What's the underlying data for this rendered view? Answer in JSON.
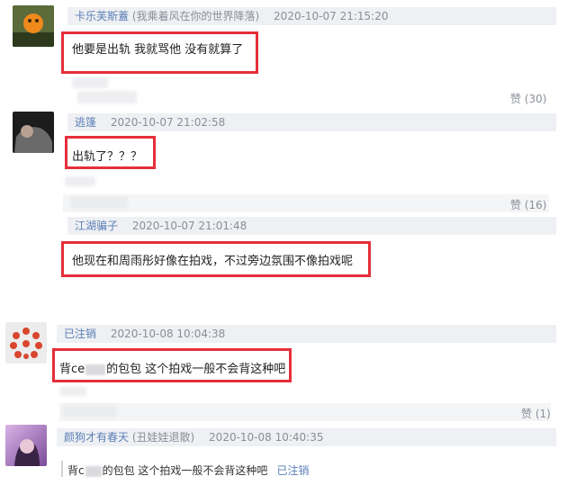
{
  "comments": [
    {
      "username": "卡乐芙斯蓋",
      "note": "(我乘着风在你的世界降落)",
      "time": "2020-10-07 21:15:20",
      "text": "他要是出轨 我就骂他 没有就算了",
      "likes": "赞 (30)"
    },
    {
      "username": "逃篷",
      "time": "2020-10-07 21:02:58",
      "text": "出轨了？？？",
      "likes": "赞 (16)"
    },
    {
      "username": "江湖骗子",
      "time": "2020-10-07 21:01:48",
      "text": "他现在和周雨彤好像在拍戏，不过旁边氛围不像拍戏呢"
    },
    {
      "username": "已注销",
      "time": "2020-10-08 10:04:38",
      "text_prefix": "背ce",
      "text_suffix": "的包包 这个拍戏一般不会背这种吧",
      "likes": "赞 (1)"
    },
    {
      "username": "颜狗才有春天",
      "note": "(丑娃娃退散)",
      "time": "2020-10-08 10:40:35",
      "reply_prefix": "背c",
      "reply_suffix": "的包包 这个拍戏一般不会背这种吧",
      "reply_author": "已注销"
    }
  ],
  "colors": {
    "highlight_box": "#e62f3a",
    "username_link": "#5b7fb6",
    "header_bg": "#eef0f3"
  }
}
